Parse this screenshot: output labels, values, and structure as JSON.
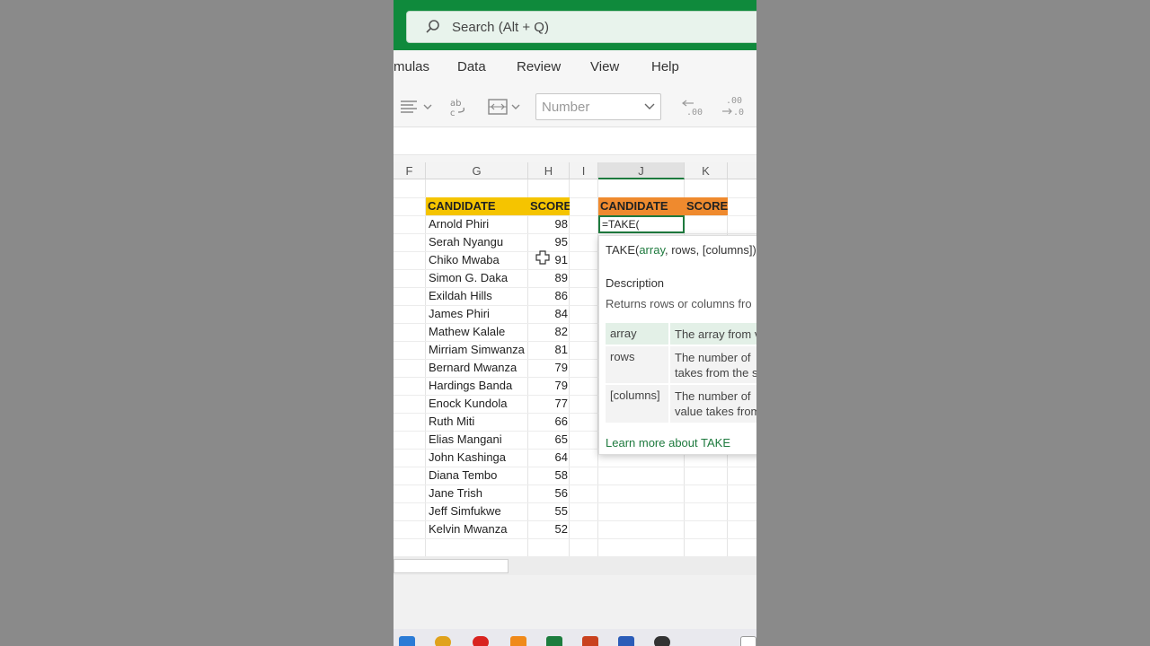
{
  "search": {
    "placeholder": "Search (Alt + Q)",
    "icon": "search-icon"
  },
  "menu": [
    "mulas",
    "Data",
    "Review",
    "View",
    "Help"
  ],
  "ribbon": {
    "number_format": "Number"
  },
  "columns": [
    "F",
    "G",
    "H",
    "I",
    "J",
    "K"
  ],
  "table1": {
    "headers": [
      "CANDIDATE",
      "SCORE"
    ],
    "rows": [
      [
        "Arnold Phiri",
        "98"
      ],
      [
        "Serah Nyangu",
        "95"
      ],
      [
        "Chiko Mwaba",
        "91"
      ],
      [
        "Simon G. Daka",
        "89"
      ],
      [
        "Exildah Hills",
        "86"
      ],
      [
        "James Phiri",
        "84"
      ],
      [
        "Mathew Kalale",
        "82"
      ],
      [
        "Mirriam Simwanza",
        "81"
      ],
      [
        "Bernard Mwanza",
        "79"
      ],
      [
        "Hardings Banda",
        "79"
      ],
      [
        "Enock Kundola",
        "77"
      ],
      [
        "Ruth Miti",
        "66"
      ],
      [
        "Elias Mangani",
        "65"
      ],
      [
        "John Kashinga",
        "64"
      ],
      [
        "Diana Tembo",
        "58"
      ],
      [
        "Jane Trish",
        "56"
      ],
      [
        "Jeff Simfukwe",
        "55"
      ],
      [
        "Kelvin Mwanza",
        "52"
      ]
    ]
  },
  "table2": {
    "headers": [
      "CANDIDATE",
      "SCORE"
    ]
  },
  "active_cell": {
    "formula": "=TAKE("
  },
  "tooltip": {
    "fn": "TAKE(",
    "arg1": "array",
    "rest": ", rows, [columns])",
    "description_title": "Description",
    "description": "Returns rows or columns fro",
    "args": [
      {
        "name": "array",
        "desc_lines": [
          "The array from v"
        ]
      },
      {
        "name": "rows",
        "desc_lines": [
          "The number of",
          "takes from the s"
        ]
      },
      {
        "name": "[columns]",
        "desc_lines": [
          "The number of",
          "value takes from"
        ]
      }
    ],
    "learn_more": "Learn more about TAKE"
  },
  "colors": {
    "title_green": "#0f8a3c",
    "header_yellow": "#f5c400",
    "header_orange": "#ef8a2e",
    "accent": "#1e7a3e"
  }
}
